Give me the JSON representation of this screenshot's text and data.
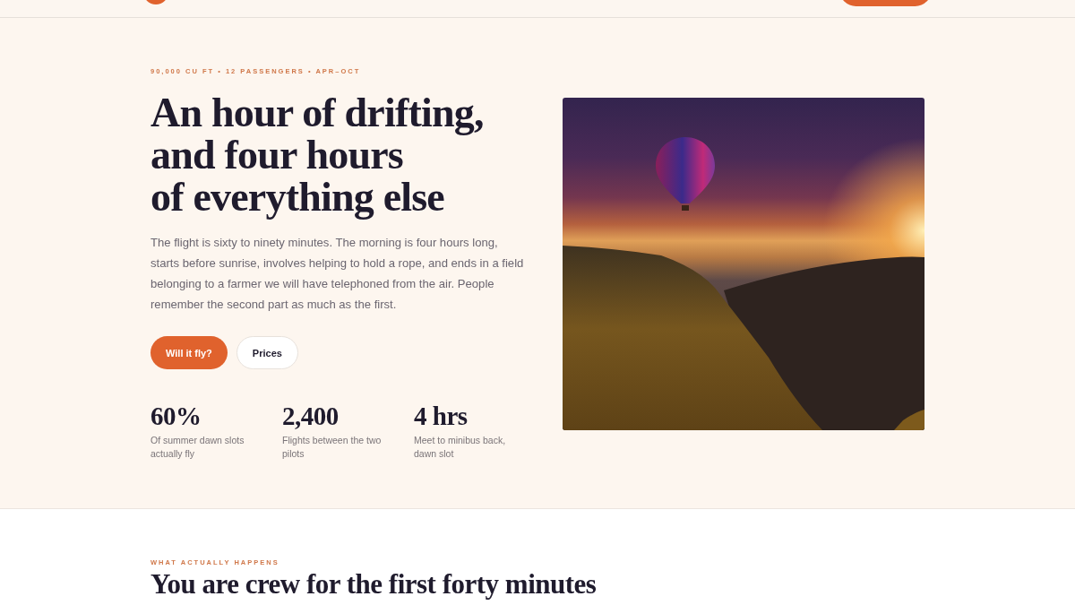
{
  "hero": {
    "eyebrow": "90,000 CU FT • 12 PASSENGERS • APR–OCT",
    "title_lines": [
      "An hour of drifting,",
      "and four hours",
      "of everything else"
    ],
    "body": "The flight is sixty to ninety minutes. The morning is four hours long, starts before sunrise, involves helping to hold a rope, and ends in a field belonging to a farmer we will have telephoned from the air. People remember the second part as much as the first.",
    "buttons": [
      {
        "label": "Will it fly?",
        "kind": "primary"
      },
      {
        "label": "Prices",
        "kind": "secondary"
      }
    ],
    "stats": [
      {
        "value": "60%",
        "label": "Of summer dawn slots actually fly"
      },
      {
        "value": "2,400",
        "label": "Flights between the two pilots"
      },
      {
        "value": "4 hrs",
        "label": "Meet to minibus back, dawn slot"
      }
    ]
  },
  "section": {
    "eyebrow": "WHAT ACTUALLY HAPPENS",
    "heading": "You are crew for the first forty minutes"
  }
}
